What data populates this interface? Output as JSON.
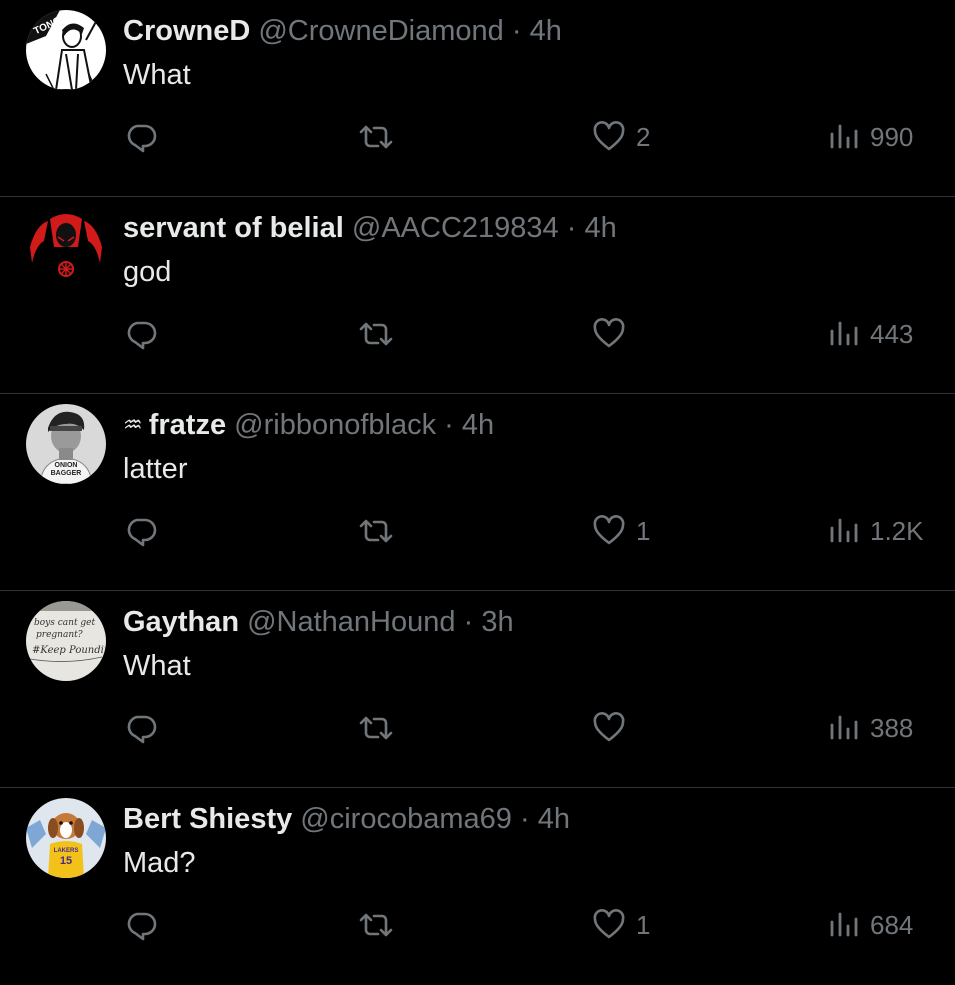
{
  "tweets": [
    {
      "name": "CrowneD",
      "prefix": "",
      "handle": "@CrowneDiamond",
      "sep": "·",
      "time": "4h",
      "text": "What",
      "replies": "",
      "retweets": "",
      "likes": "2",
      "views": "990",
      "avatar": {
        "theme": "manga",
        "bg": "#ffffff",
        "label": "TONG"
      }
    },
    {
      "name": "servant of belial",
      "prefix": "",
      "handle": "@AACC219834",
      "sep": "·",
      "time": "4h",
      "text": "god",
      "replies": "",
      "retweets": "",
      "likes": "",
      "views": "443",
      "avatar": {
        "theme": "red-dark",
        "bg": "#000000",
        "label": ""
      }
    },
    {
      "name": "fratze",
      "prefix": "♒",
      "handle": "@ribbonofblack",
      "sep": "·",
      "time": "4h",
      "text": "latter",
      "replies": "",
      "retweets": "",
      "likes": "1",
      "views": "1.2K",
      "avatar": {
        "theme": "person-bw",
        "bg": "#d9d9d9",
        "label": "ONION BAGGER"
      }
    },
    {
      "name": "Gaythan",
      "prefix": "",
      "handle": "@NathanHound",
      "sep": "·",
      "time": "3h",
      "text": "What",
      "replies": "",
      "retweets": "",
      "likes": "",
      "views": "388",
      "avatar": {
        "theme": "handwriting",
        "bg": "#e8e6e1",
        "label": "boys cant get pregnant? #Keep Pounding"
      }
    },
    {
      "name": "Bert Shiesty",
      "prefix": "",
      "handle": "@cirocobama69",
      "sep": "·",
      "time": "4h",
      "text": "Mad?",
      "replies": "",
      "retweets": "",
      "likes": "1",
      "views": "684",
      "avatar": {
        "theme": "dog-lakers",
        "bg": "#dfe6ee",
        "label": "LAKERS 15"
      }
    }
  ],
  "colors": {
    "background": "#000000",
    "text": "#e7e9ea",
    "muted": "#71767b",
    "divider": "#2f3336"
  },
  "icons": {
    "reply": "reply-icon",
    "retweet": "retweet-icon",
    "like": "heart-icon",
    "views": "views-icon"
  }
}
